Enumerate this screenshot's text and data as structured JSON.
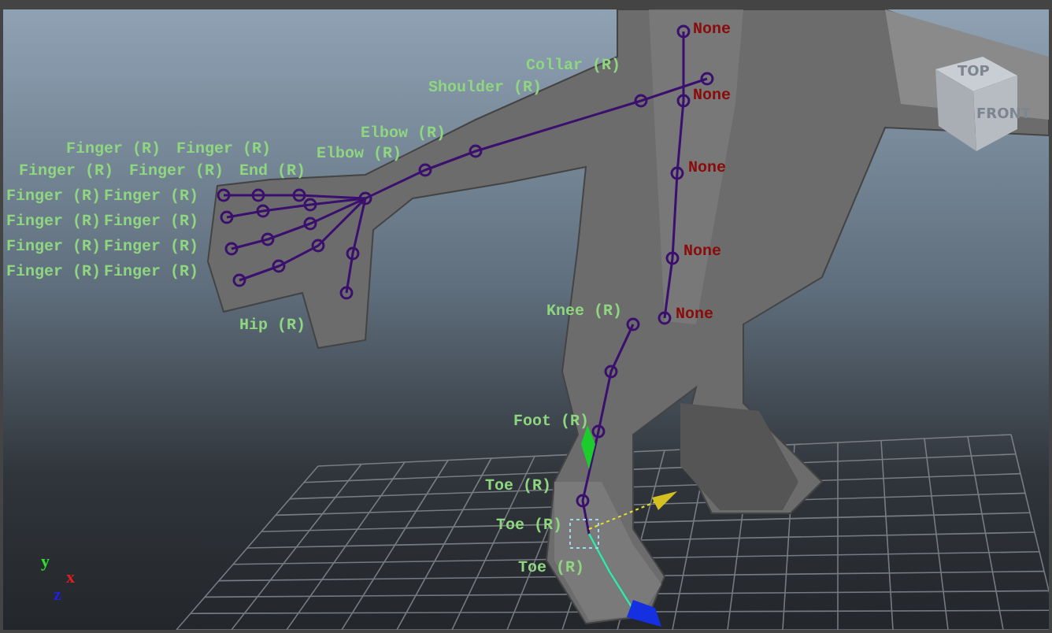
{
  "viewport": {
    "joint_labels": [
      {
        "text": "None",
        "color": "#8b0a0a"
      },
      {
        "text": "None",
        "color": "#8b0a0a"
      },
      {
        "text": "None",
        "color": "#8b0a0a"
      },
      {
        "text": "None",
        "color": "#8b0a0a"
      },
      {
        "text": "None",
        "color": "#8b0a0a"
      },
      {
        "text": "Collar (R)",
        "color": "#8fd680"
      },
      {
        "text": "Shoulder (R)",
        "color": "#8fd680"
      },
      {
        "text": "Elbow (R)",
        "color": "#8fd680"
      },
      {
        "text": "Finger (R)",
        "color": "#8fd680"
      },
      {
        "text": "Finger (R)",
        "color": "#8fd680"
      },
      {
        "text": "Elbow (R)",
        "color": "#8fd680"
      },
      {
        "text": "Finger (R)",
        "color": "#8fd680"
      },
      {
        "text": "Finger (R)",
        "color": "#8fd680"
      },
      {
        "text": "End (R)",
        "color": "#8fd680"
      },
      {
        "text": "Finger (R)",
        "color": "#8fd680"
      },
      {
        "text": "Finger (R)",
        "color": "#8fd680"
      },
      {
        "text": "Finger (R)",
        "color": "#8fd680"
      },
      {
        "text": "Finger (R)",
        "color": "#8fd680"
      },
      {
        "text": "Finger (R)",
        "color": "#8fd680"
      },
      {
        "text": "Finger (R)",
        "color": "#8fd680"
      },
      {
        "text": "Finger (R)",
        "color": "#8fd680"
      },
      {
        "text": "Finger (R)",
        "color": "#8fd680"
      },
      {
        "text": "Hip (R)",
        "color": "#8fd680"
      },
      {
        "text": "Knee (R)",
        "color": "#8fd680"
      },
      {
        "text": "Foot (R)",
        "color": "#8fd680"
      },
      {
        "text": "Toe (R)",
        "color": "#8fd680"
      },
      {
        "text": "Toe (R)",
        "color": "#8fd680"
      },
      {
        "text": "Toe (R)",
        "color": "#8fd680"
      }
    ],
    "view_cube": {
      "top": "TOP",
      "front": "FRONT"
    },
    "axes": {
      "y": "y",
      "x": "x",
      "z": "z"
    }
  }
}
